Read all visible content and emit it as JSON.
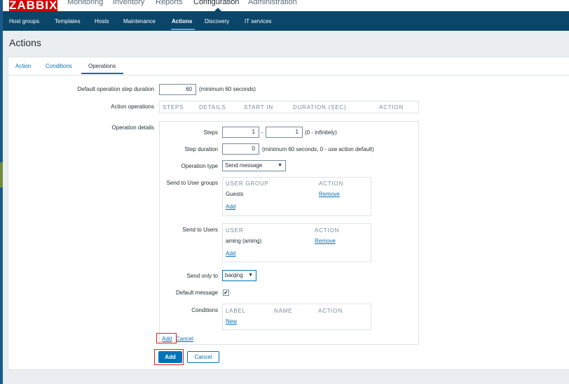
{
  "app": {
    "logo": "ZABBIX"
  },
  "top_menu": [
    "Monitoring",
    "Inventory",
    "Reports",
    "Configuration",
    "Administration"
  ],
  "sub_menu": [
    "Host groups",
    "Templates",
    "Hosts",
    "Maintenance",
    "Actions",
    "Discovery",
    "IT services"
  ],
  "page": {
    "title": "Actions"
  },
  "tabs": [
    "Action",
    "Conditions",
    "Operations"
  ],
  "form": {
    "step_duration": {
      "label": "Default operation step duration",
      "value": "60",
      "hint": "(minimum 60 seconds)"
    },
    "action_operations": {
      "label": "Action operations",
      "columns": [
        "STEPS",
        "DETAILS",
        "START IN",
        "DURATION (SEC)",
        "ACTION"
      ]
    },
    "operation_details": {
      "label": "Operation details",
      "steps": {
        "label": "Steps",
        "from": "1",
        "dash": "-",
        "to": "1",
        "hint": "(0 - infinitely)"
      },
      "step_duration": {
        "label": "Step duration",
        "value": "0",
        "hint": "(minimum 60 seconds, 0 - use action default)"
      },
      "operation_type": {
        "label": "Operation type",
        "value": "Send message"
      },
      "user_groups": {
        "label": "Send to User groups",
        "columns": [
          "USER GROUP",
          "ACTION"
        ],
        "rows": [
          {
            "name": "Guests",
            "action": "Remove"
          }
        ],
        "add": "Add"
      },
      "users": {
        "label": "Send to Users",
        "columns": [
          "USER",
          "ACTION"
        ],
        "rows": [
          {
            "name": "aming (aming)",
            "action": "Remove"
          }
        ],
        "add": "Add"
      },
      "send_only_to": {
        "label": "Send only to",
        "value": "baojing"
      },
      "default_message": {
        "label": "Default message",
        "checked": "✔"
      },
      "conditions": {
        "label": "Conditions",
        "columns": [
          "LABEL",
          "NAME",
          "ACTION"
        ],
        "new": "New"
      },
      "add_link": "Add",
      "cancel_link": "Cancel"
    }
  },
  "buttons": {
    "add": "Add",
    "cancel": "Cancel"
  },
  "colors": {
    "brand": "#d40000",
    "nav": "#0a466a",
    "link": "#0a6eb4",
    "primary": "#0275b8",
    "highlight": "#e02020"
  }
}
